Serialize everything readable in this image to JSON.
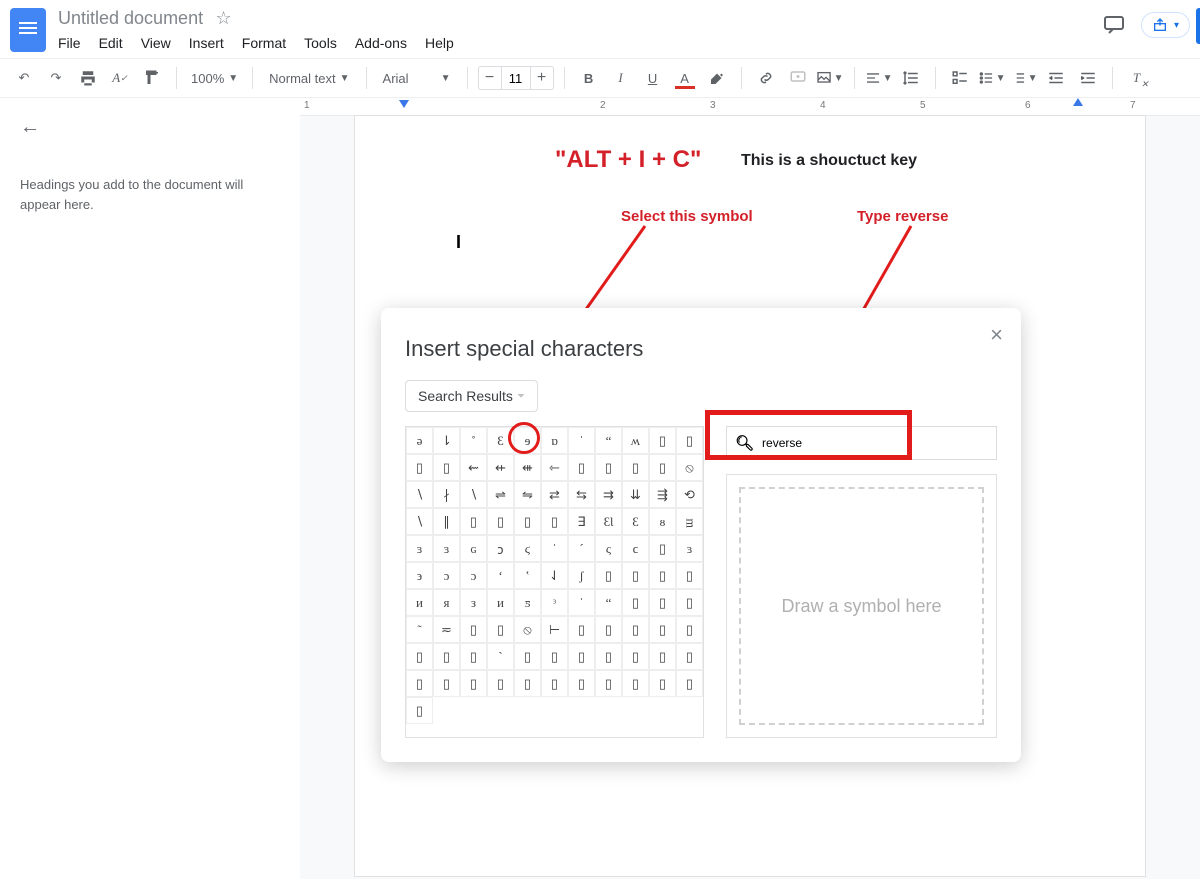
{
  "doc": {
    "title": "Untitled document"
  },
  "menu": {
    "file": "File",
    "edit": "Edit",
    "view": "View",
    "insert": "Insert",
    "format": "Format",
    "tools": "Tools",
    "addons": "Add-ons",
    "help": "Help"
  },
  "toolbar": {
    "zoom": "100%",
    "style": "Normal text",
    "font": "Arial",
    "size": "11"
  },
  "outline": {
    "hint": "Headings you add to the document will appear here."
  },
  "annotations": {
    "shortcut": "\"ALT + I + C\"",
    "shortcut_note": "This is a shouctuct key",
    "select": "Select this symbol",
    "type": "Type reverse",
    "cursor": "I"
  },
  "dialog": {
    "title": "Insert special characters",
    "chip": "Search Results",
    "search": "reverse",
    "search_placeholder": "",
    "draw_hint": "Draw a symbol here",
    "rows": [
      [
        "ə",
        "⇂",
        "˚",
        "Ɛ",
        "ɘ",
        "ɒ",
        "ˈ",
        "“",
        "ʍ",
        "▯",
        "▯"
      ],
      [
        "▯",
        "▯",
        "⇜",
        "⇷",
        "⇺",
        "⇽",
        "▯",
        "▯",
        "▯",
        "▯",
        "⦸"
      ],
      [
        "∖",
        "∤",
        "∖",
        "⇌",
        "⇋",
        "⇄",
        "⇆",
        "⇉",
        "⇊",
        "⇶",
        "⟲"
      ],
      [
        "∖",
        "∥",
        "▯",
        "▯",
        "▯",
        "▯",
        "∃",
        "ƐƖ",
        "Ɛ",
        "ᴕ",
        "ᴟ"
      ],
      [
        "ɜ",
        "ɜ",
        "ɢ",
        "𐑋",
        "ϛ",
        "ˈ",
        "ˊ",
        "ς",
        "ϲ",
        "▯",
        "ɜ"
      ],
      [
        "϶",
        "ɔ",
        "ɔ",
        "ʻ",
        "ʽ",
        "⇃",
        "ʃ",
        "▯",
        "▯",
        "▯",
        "▯"
      ],
      [
        "ᴎ",
        "ᴙ",
        "ᴈ",
        "ᴎ",
        "ƽ",
        "ᵌ",
        "ˈ",
        "“",
        "▯",
        "▯",
        "▯"
      ],
      [
        "˜",
        "≂",
        "▯",
        "▯",
        "⦸",
        "⊢",
        "▯",
        "▯",
        "▯",
        "▯",
        "▯"
      ],
      [
        "▯",
        "▯",
        "▯",
        "ˋ",
        "▯",
        "▯",
        "▯",
        "▯",
        "▯",
        "▯",
        "▯"
      ],
      [
        "▯",
        "▯",
        "▯",
        "▯",
        "▯",
        "▯",
        "▯",
        "▯",
        "▯",
        "▯",
        "▯"
      ],
      [
        "▯"
      ]
    ]
  },
  "ruler": {
    "ticks": [
      "1",
      "2",
      "3",
      "4",
      "5",
      "6",
      "7"
    ]
  }
}
